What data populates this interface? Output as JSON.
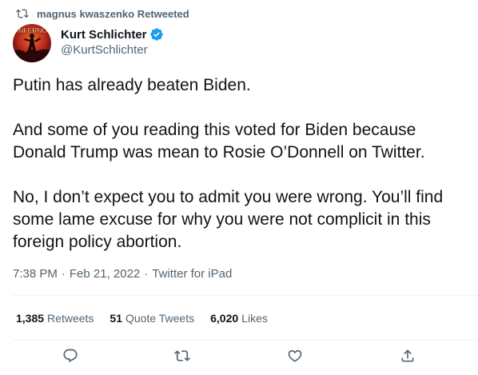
{
  "retweet_context": {
    "text": "magnus kwaszenko Retweeted",
    "icon": "retweet-icon"
  },
  "author": {
    "display_name": "Kurt Schlichter",
    "handle": "@KurtSchlichter",
    "verified": true,
    "avatar_text": "INFERNO"
  },
  "tweet": {
    "paragraphs": [
      "Putin has already beaten Biden.",
      "And some of you reading this voted for Biden because Donald Trump was mean to Rosie O’Donnell on Twitter.",
      "No, I don’t expect you to admit you were wrong. You’ll find some lame excuse for why you were not complicit in this foreign policy abortion."
    ],
    "time": "7:38 PM",
    "date": "Feb 21, 2022",
    "source": "Twitter for iPad",
    "separator": "·"
  },
  "stats": {
    "retweets_count": "1,385",
    "retweets_label": "Retweets",
    "quotes_count": "51",
    "quotes_label": "Quote Tweets",
    "likes_count": "6,020",
    "likes_label": "Likes"
  },
  "actions": [
    "reply-icon",
    "retweet-icon",
    "like-icon",
    "share-icon"
  ],
  "colors": {
    "text": "#0f1419",
    "secondary": "#536471",
    "verified": "#1d9bf0",
    "divider": "#eff3f4"
  }
}
